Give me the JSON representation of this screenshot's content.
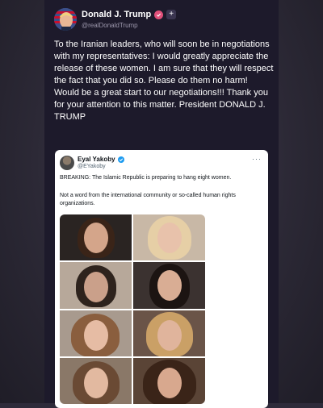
{
  "post": {
    "display_name": "Donald J. Trump",
    "handle": "@realDonaldTrump",
    "body": "To the Iranian leaders, who will soon be in negotiations with my representatives: I would greatly appreciate the release of these women. I am sure that they will respect the fact that you did so. Please do them no harm! Would be a great start to our negotiations!!! Thank you for your attention to this matter. President DONALD J. TRUMP",
    "plus_label": "+",
    "colors": {
      "background": "#1d1a2b",
      "text": "#ffffff",
      "handle": "#9d98ad",
      "badge": "#e1507a"
    }
  },
  "quoted_post": {
    "display_name": "Eyal Yakoby",
    "handle": "@EYakoby",
    "more_label": "···",
    "text_1": "BREAKING: The Islamic Republic is preparing to hang eight women.",
    "text_2": "Not a word from the international community or so-called human rights organizations.",
    "photo_count": 8,
    "colors": {
      "background": "#ffffff",
      "text": "#0f1419",
      "handle": "#536471",
      "verified": "#1d9bf0"
    }
  }
}
